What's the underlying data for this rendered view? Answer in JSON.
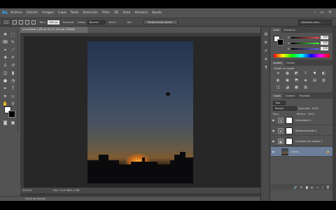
{
  "app": {
    "logo": "Ps"
  },
  "menu": [
    "Archivo",
    "Edición",
    "Imagen",
    "Capa",
    "Texto",
    "Selección",
    "Filtro",
    "3D",
    "Vista",
    "Ventana",
    "Ayuda"
  ],
  "window_controls": {
    "minimize": "–",
    "restore": "▭",
    "close": "✕"
  },
  "options": {
    "size_label": "Tam.:",
    "size_value": "300 px",
    "feather_label": "Suavizar",
    "style_label": "Estilo:",
    "style_value": "Normal",
    "width_label": "Anch.:",
    "height_label": "Alt.:",
    "refine_button": "Perfeccionar borde...",
    "workspace": "Aspectos esen..."
  },
  "document": {
    "tab_title": "sc-nombre-1.JPG al 34,7% (Fondo, RGB/8)",
    "zoom": "34,67%",
    "doc_info": "Doc: 13,9 MB/1,3 MB"
  },
  "timeline_label": "Línea de tiempo",
  "color_panel": {
    "tabs": [
      "Color",
      "Muestras"
    ],
    "sliders": [
      {
        "label": "R",
        "value": "255",
        "color": "#ff4a4a"
      },
      {
        "label": "G",
        "value": "255",
        "color": "#4aff4a"
      },
      {
        "label": "B",
        "value": "255",
        "color": "#6a6aff"
      }
    ]
  },
  "adjust_panel": {
    "tabs": [
      "Ajustes",
      "Estilos"
    ],
    "title": "Añadir un ajuste",
    "icons": [
      "☀",
      "▦",
      "◩",
      "▽",
      "▼",
      "◧",
      "◐",
      "▣",
      "⬒",
      "◈",
      "▤",
      "▥",
      "◫",
      "◪",
      "▩",
      "▨"
    ]
  },
  "layers_panel": {
    "tabs": [
      "Capas",
      "Canales",
      "Trazados"
    ],
    "filter": "Tipo",
    "blend_mode": "Normal",
    "opacity_label": "Opacidad:",
    "opacity_value": "100%",
    "lock_label": "Bloq.:",
    "fill_label": "Relleno:",
    "fill_value": "100%",
    "layers": [
      {
        "name": "Intensidad 1",
        "icon": "▽"
      },
      {
        "name": "Brillo/contraste 1",
        "icon": "☀"
      },
      {
        "name": "Consulta de colores 1",
        "icon": "▦"
      },
      {
        "name": "Fondo",
        "icon": ""
      }
    ],
    "bottom_icons": [
      "🔗",
      "fx",
      "◙",
      "◐",
      "▭",
      "▯",
      "🗑"
    ]
  },
  "colors": {
    "accent_selected_layer": "#6c7e98",
    "app_bg": "#535353"
  }
}
